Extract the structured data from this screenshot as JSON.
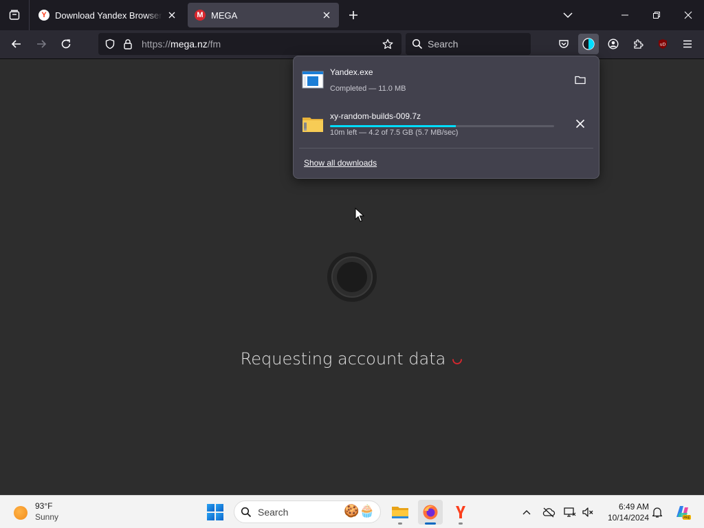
{
  "browser": {
    "tabs": [
      {
        "title": "Download Yandex Browser (bet",
        "favicon": "yandex-icon"
      },
      {
        "title": "MEGA",
        "favicon": "mega-icon",
        "active": true
      }
    ],
    "favicon_letters": {
      "yandex": "Y",
      "mega": "M"
    },
    "url": {
      "prefix": "https://",
      "host": "mega.nz",
      "path": "/fm"
    },
    "search_placeholder": "Search",
    "colors": {
      "accent": "#00ddff",
      "mega_red": "#d9272e",
      "yandex_red": "#fc3f1d",
      "ublock_red": "#800000"
    }
  },
  "downloads": {
    "items": [
      {
        "name": "Yandex.exe",
        "meta": "Completed — 11.0 MB",
        "action": "folder-icon"
      },
      {
        "name": "xy-random-builds-009.7z",
        "meta": "10m left — 4.2 of 7.5 GB (5.7 MB/sec)",
        "progress": 0.56,
        "action": "close-icon"
      }
    ],
    "show_all": "Show all downloads"
  },
  "page": {
    "status_text": "Requesting account data"
  },
  "taskbar": {
    "weather": {
      "temp": "93°F",
      "condition": "Sunny"
    },
    "search_placeholder": "Search",
    "clock": {
      "time": "6:49 AM",
      "date": "10/14/2024"
    }
  }
}
